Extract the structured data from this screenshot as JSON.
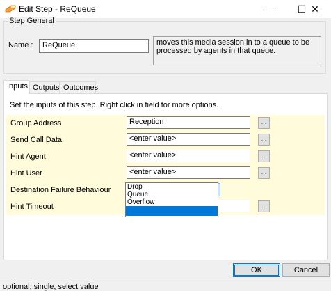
{
  "window": {
    "title": "Edit Step - ReQueue",
    "minimize": "—",
    "maximize": "☐",
    "close": "✕",
    "icon": "step-icon"
  },
  "step_general": {
    "legend": "Step General",
    "name_label": "Name :",
    "name_value": "ReQueue",
    "description": "moves this media session in to a queue to be processed by agents in that queue."
  },
  "tabs": [
    {
      "label": "Inputs",
      "active": true
    },
    {
      "label": "Outputs",
      "active": false
    },
    {
      "label": "Outcomes",
      "active": false
    }
  ],
  "inputs": {
    "instructions": "Set the inputs of this step.  Right click in field for more options.",
    "rows": [
      {
        "label": "Group Address",
        "value": "Reception",
        "button": "..."
      },
      {
        "label": "Send Call Data",
        "value": "<enter value>",
        "button": "..."
      },
      {
        "label": "Hint Agent",
        "value": "<enter value>",
        "button": "..."
      },
      {
        "label": "Hint User",
        "value": "<enter value>",
        "button": "..."
      },
      {
        "label": "Destination Failure Behaviour",
        "value": ""
      },
      {
        "label": "Hint Timeout",
        "value": "",
        "button": "..."
      }
    ],
    "dropdown_options": [
      "Drop",
      "Queue",
      "Overflow",
      ""
    ]
  },
  "buttons": {
    "ok": "OK",
    "cancel": "Cancel"
  },
  "status": {
    "text": "optional, single, select value"
  },
  "colors": {
    "row_background": "#fffbdb",
    "selection_blue": "#0078d7",
    "dropdown_focus": "#cce4f7"
  }
}
